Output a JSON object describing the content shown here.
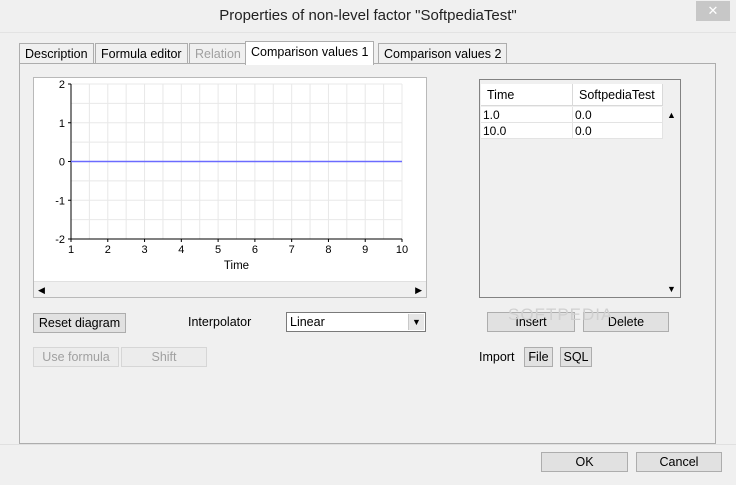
{
  "window": {
    "title": "Properties of non-level factor \"SoftpediaTest\"",
    "close_glyph": "✕"
  },
  "tabs": [
    {
      "label": "Description",
      "state": "normal"
    },
    {
      "label": "Formula editor",
      "state": "normal"
    },
    {
      "label": "Relation",
      "state": "disabled"
    },
    {
      "label": "Comparison values 1",
      "state": "active"
    },
    {
      "label": "Comparison values 2",
      "state": "normal"
    }
  ],
  "chart_data": {
    "type": "line",
    "xlabel": "Time",
    "ylabel": "",
    "xlim": [
      1,
      10
    ],
    "ylim": [
      -2,
      2
    ],
    "x_ticks": [
      "1",
      "2",
      "3",
      "4",
      "5",
      "6",
      "7",
      "8",
      "9",
      "10"
    ],
    "y_ticks": [
      "2",
      "1",
      "0",
      "-1",
      "-2"
    ],
    "grid": true,
    "series": [
      {
        "x": [
          1.0,
          10.0
        ],
        "y": [
          0.0,
          0.0
        ],
        "color": "#6b6bff"
      }
    ]
  },
  "controls": {
    "reset_diagram": "Reset diagram",
    "interpolator_label": "Interpolator",
    "interpolator_value": "Linear",
    "use_formula": "Use formula",
    "shift": "Shift",
    "insert": "Insert",
    "delete": "Delete",
    "import_label": "Import",
    "file": "File",
    "sql": "SQL"
  },
  "table": {
    "headers": [
      "Time",
      "SoftpediaTest"
    ],
    "rows": [
      [
        "1.0",
        "0.0"
      ],
      [
        "10.0",
        "0.0"
      ]
    ]
  },
  "footer": {
    "ok": "OK",
    "cancel": "Cancel"
  },
  "watermark": {
    "text": "SOFTPEDIA"
  },
  "colors": {
    "accent_line": "#6b6bff",
    "grid": "#e8e8e8"
  }
}
